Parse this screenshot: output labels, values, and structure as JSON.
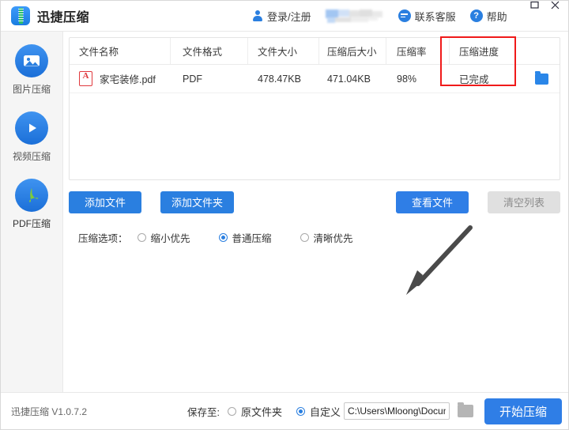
{
  "window": {
    "title": "迅捷压缩",
    "controls": [
      {
        "name": "maximize",
        "glyph": "maximize-icon"
      },
      {
        "name": "close",
        "glyph": "close-icon"
      }
    ]
  },
  "header": {
    "brand": "迅捷压缩",
    "login": "登录/注册",
    "service": "联系客服",
    "help": "帮助",
    "help_glyph": "?",
    "censored_region": true
  },
  "sidebar": {
    "items": [
      {
        "label": "图片压缩",
        "icon": "image-icon",
        "active": false
      },
      {
        "label": "视频压缩",
        "icon": "play-icon",
        "active": false
      },
      {
        "label": "PDF压缩",
        "icon": "pdf-icon",
        "active": true
      }
    ]
  },
  "table": {
    "columns": [
      "文件名称",
      "文件格式",
      "文件大小",
      "压缩后大小",
      "压缩率",
      "压缩进度"
    ],
    "rows": [
      {
        "file_name": "家宅装修.pdf",
        "format": "PDF",
        "size": "478.47KB",
        "compressed_size": "471.04KB",
        "rate": "98%",
        "progress": "已完成",
        "open_folder_icon": "folder-icon",
        "remove_icon": "close-icon"
      }
    ]
  },
  "annotations": {
    "highlight_color": "#f01a1a",
    "arrow_color": "#4a4a4a",
    "highlight_target": "压缩进度",
    "arrow_target": "查看文件"
  },
  "actions": {
    "add_file": "添加文件",
    "add_folder": "添加文件夹",
    "view_file": "查看文件",
    "clear_list": "清空列表"
  },
  "options": {
    "label": "压缩选项：",
    "items": [
      {
        "label": "缩小优先",
        "selected": false
      },
      {
        "label": "普通压缩",
        "selected": true
      },
      {
        "label": "清晰优先",
        "selected": false
      }
    ]
  },
  "footer": {
    "version": "迅捷压缩 V1.0.7.2",
    "save_label": "保存至:",
    "save_options": [
      {
        "label": "原文件夹",
        "selected": false
      },
      {
        "label": "自定义",
        "selected": true
      }
    ],
    "path_value": "C:\\Users\\Mloong\\Documents",
    "browse_icon": "folder-icon",
    "start_button": "开始压缩"
  },
  "colors": {
    "accent": "#2a7fe0",
    "primary_button": "#2f7ee6",
    "sidebar_bg": "#f5f5f5",
    "pdf_red": "#e0393e",
    "annotation_red": "#f01a1a"
  }
}
